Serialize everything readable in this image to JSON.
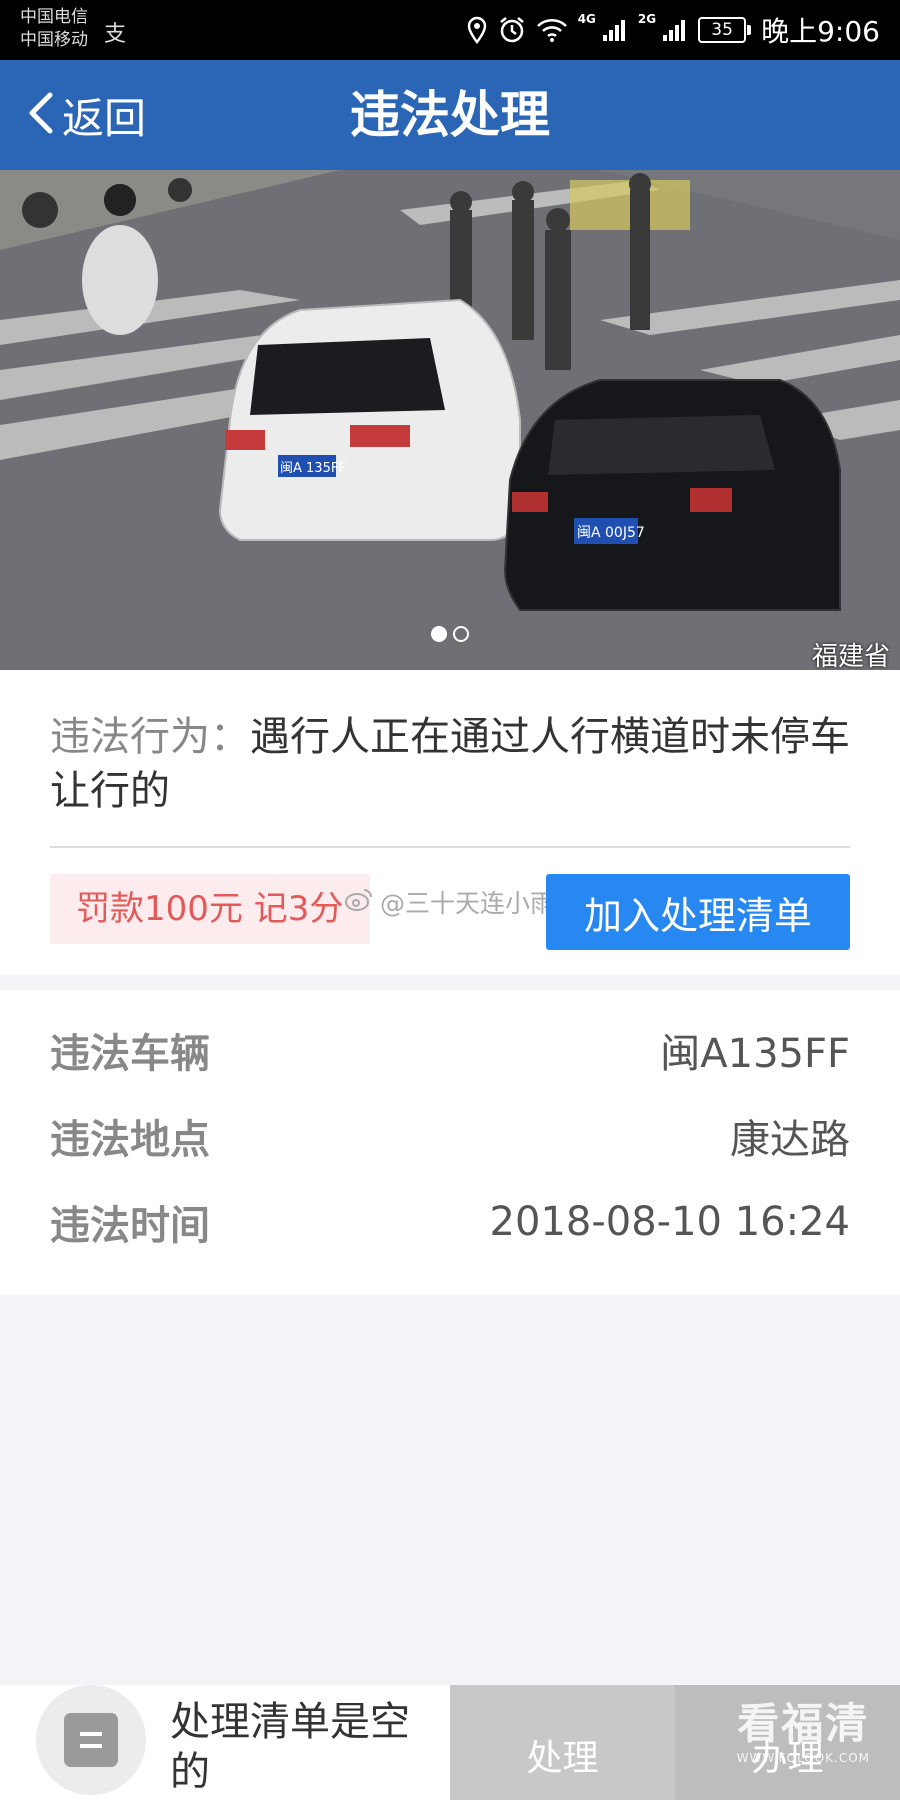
{
  "status_bar": {
    "carrier_1": "中国电信",
    "carrier_2": "中国移动",
    "carrier_extra": "支",
    "network_1": "4G",
    "network_2": "2G",
    "battery": "35",
    "time": "晚上9:06"
  },
  "nav": {
    "back_label": "返回",
    "title": "违法处理"
  },
  "photo": {
    "plate_white_car": "闽A 135FF",
    "plate_black_car": "闽A 00J57",
    "watermark": "福建省",
    "page_count": 2,
    "current_page": 1
  },
  "violation": {
    "behavior_label": "违法行为：",
    "behavior_text": "遇行人正在通过人行横道时未停车让行的",
    "fine_text": "罚款100元 记3分",
    "weibo_watermark": "@三十天连小雨",
    "add_button_label": "加入处理清单"
  },
  "details": [
    {
      "label": "违法车辆",
      "value": "闽A135FF"
    },
    {
      "label": "违法地点",
      "value": "康达路"
    },
    {
      "label": "违法时间",
      "value": "2018-08-10 16:24"
    }
  ],
  "bottom": {
    "empty_text": "处理清单是空的",
    "process_label": "处理",
    "pay_label": "办理",
    "site_watermark": "看福清",
    "site_url": "WWW.FQLOOK.COM"
  },
  "colors": {
    "nav_blue": "#2b65b5",
    "button_blue": "#2688f0",
    "fine_red": "#e45a5a",
    "fine_bg": "#fdeced"
  }
}
